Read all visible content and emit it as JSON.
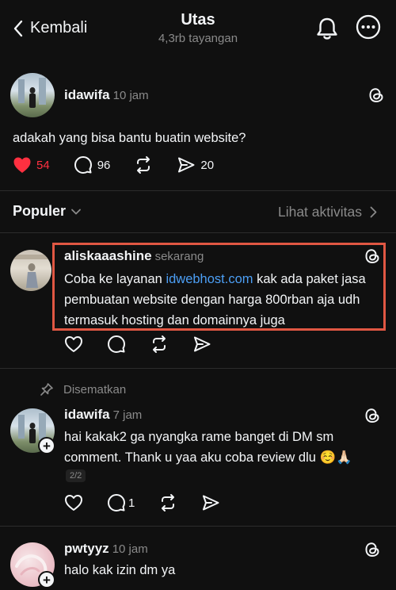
{
  "header": {
    "back_label": "Kembali",
    "title": "Utas",
    "views": "4,3rb tayangan"
  },
  "main_post": {
    "username": "idawifa",
    "time": "10 jam",
    "text": "adakah yang bisa bantu buatin website?",
    "likes": "54",
    "replies": "96",
    "shares": "20"
  },
  "sort": {
    "label": "Populer",
    "activity_label": "Lihat aktivitas"
  },
  "replies": [
    {
      "username": "aliskaaashine",
      "time": "sekarang",
      "text_before": "Coba ke layanan ",
      "link": "idwebhost.com",
      "text_after": " kak ada paket jasa pembuatan website dengan harga 800rban aja udh termasuk hosting dan domainnya juga"
    },
    {
      "pinned_label": "Disematkan",
      "username": "idawifa",
      "time": "7 jam",
      "text": "hai kakak2 ga nyangka rame banget di DM sm comment. Thank u yaa aku coba review dlu ☺️🙏🏻",
      "counter": "2/2",
      "replies": "1"
    },
    {
      "username": "pwtyyz",
      "time": "10 jam",
      "text": "halo kak izin dm ya"
    }
  ],
  "colors": {
    "background": "#101010",
    "like_red": "#ff3040",
    "link_blue": "#4c9ff5",
    "highlight": "#e05743"
  },
  "icons": [
    "chevron-left-icon",
    "bell-icon",
    "more-icon",
    "threads-icon",
    "heart-icon",
    "comment-icon",
    "repost-icon",
    "send-icon",
    "chevron-down-icon",
    "chevron-right-icon",
    "pin-icon",
    "plus-icon"
  ]
}
